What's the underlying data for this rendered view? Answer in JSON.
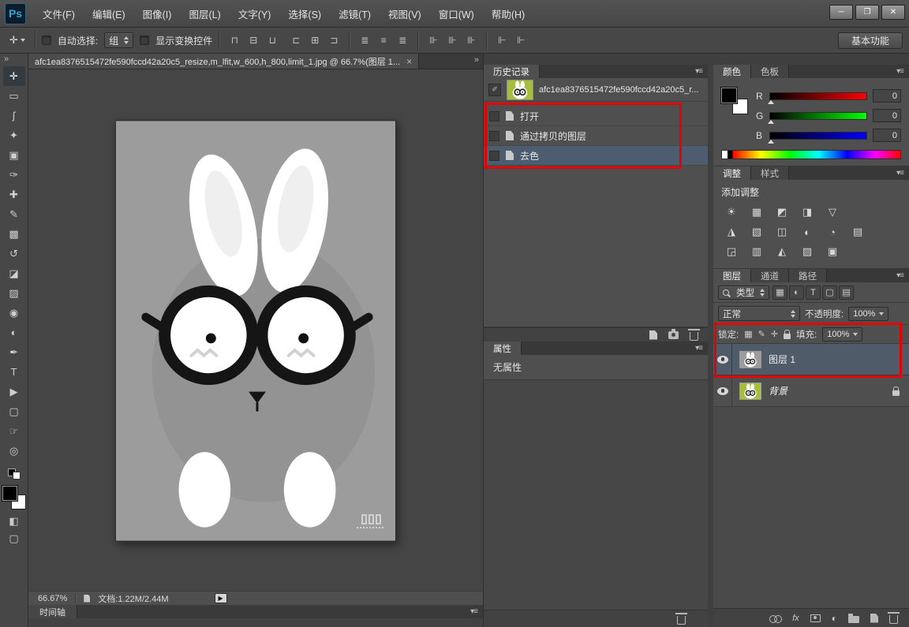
{
  "window": {
    "logo": "Ps",
    "menus": [
      "文件(F)",
      "编辑(E)",
      "图像(I)",
      "图层(L)",
      "文字(Y)",
      "选择(S)",
      "滤镜(T)",
      "视图(V)",
      "窗口(W)",
      "帮助(H)"
    ],
    "controls": {
      "minimize": "─",
      "restore": "❐",
      "close": "✕"
    }
  },
  "options_bar": {
    "tool_icon": "✛",
    "auto_select_label": "自动选择:",
    "auto_select_value": "组",
    "show_transform_label": "显示变换控件",
    "workspace_button": "基本功能",
    "align_g1": [
      "⊓",
      "⊟",
      "⊔"
    ],
    "align_g2": [
      "⊏",
      "⊞",
      "⊐"
    ],
    "align_g3": [
      "≣",
      "≡",
      "≣"
    ],
    "align_g4": [
      "⊪",
      "⊪",
      "⊪"
    ],
    "align_g5": [
      "⊩",
      "⊩"
    ]
  },
  "toolbar": {
    "tools": [
      {
        "n": "move-tool-icon",
        "g": "✛"
      },
      {
        "n": "rectangular-marquee-tool-icon",
        "g": "▭"
      },
      {
        "n": "lasso-tool-icon",
        "g": "ʃ"
      },
      {
        "n": "quick-selection-tool-icon",
        "g": "✦"
      },
      {
        "n": "crop-tool-icon",
        "g": "▣"
      },
      {
        "n": "eyedropper-tool-icon",
        "g": "✑"
      },
      {
        "n": "healing-brush-tool-icon",
        "g": "✚"
      },
      {
        "n": "brush-tool-icon",
        "g": "✎"
      },
      {
        "n": "clone-stamp-tool-icon",
        "g": "▩"
      },
      {
        "n": "history-brush-tool-icon",
        "g": "↺"
      },
      {
        "n": "eraser-tool-icon",
        "g": "◪"
      },
      {
        "n": "gradient-tool-icon",
        "g": "▨"
      },
      {
        "n": "blur-tool-icon",
        "g": "◉"
      },
      {
        "n": "dodge-tool-icon",
        "g": "◐"
      },
      {
        "n": "pen-tool-icon",
        "g": "✒"
      },
      {
        "n": "type-tool-icon",
        "g": "T"
      },
      {
        "n": "path-selection-tool-icon",
        "g": "▶"
      },
      {
        "n": "shape-tool-icon",
        "g": "▢"
      },
      {
        "n": "hand-tool-icon",
        "g": "☞"
      },
      {
        "n": "zoom-tool-icon",
        "g": "◎"
      }
    ]
  },
  "document": {
    "tab_title": "afc1ea8376515472fe590fccd42a20c5_resize,m_lfit,w_600,h_800,limit_1.jpg @ 66.7%(图层 1...",
    "zoom": "66.67%",
    "doc_info": "文档:1.22M/2.44M"
  },
  "history": {
    "title": "历史记录",
    "snapshot_name": "afc1ea8376515472fe590fccd42a20c5_r...",
    "items": [
      "打开",
      "通过拷贝的图层",
      "去色"
    ]
  },
  "properties": {
    "title": "属性",
    "empty": "无属性"
  },
  "color": {
    "tabs": [
      "颜色",
      "色板"
    ],
    "sliders": [
      {
        "label": "R",
        "value": "0"
      },
      {
        "label": "G",
        "value": "0"
      },
      {
        "label": "B",
        "value": "0"
      }
    ]
  },
  "adjustments": {
    "tabs": [
      "调整",
      "样式"
    ],
    "add_label": "添加调整",
    "row1": [
      "☀",
      "▦",
      "◩",
      "◨",
      "▽"
    ],
    "row2": [
      "◮",
      "▧",
      "◫",
      "◐",
      "◔",
      "▤"
    ],
    "row3": [
      "◲",
      "▥",
      "◭",
      "▨",
      "▣"
    ]
  },
  "layers": {
    "tabs": [
      "图层",
      "通道",
      "路径"
    ],
    "filter_label": "类型",
    "filter_icons": [
      "▦",
      "◐",
      "T",
      "▢",
      "▤"
    ],
    "blend_mode": "正常",
    "opacity_label": "不透明度:",
    "opacity_value": "100%",
    "lock_label": "锁定:",
    "lock_icons": [
      "▦",
      "✎",
      "✛"
    ],
    "fill_label": "填充:",
    "fill_value": "100%",
    "layer1_name": "图层 1",
    "background_name": "背景",
    "fx_label": "fx"
  },
  "timeline": {
    "title": "时间轴"
  },
  "icons": {
    "panel_menu": "▾≡",
    "collapse": "»",
    "tab_close": "×",
    "flyout": "▶"
  },
  "colors": {
    "annotation": "#e80000",
    "selection": "#4d5c6f",
    "canvas_bg": "#9c9c9c"
  }
}
